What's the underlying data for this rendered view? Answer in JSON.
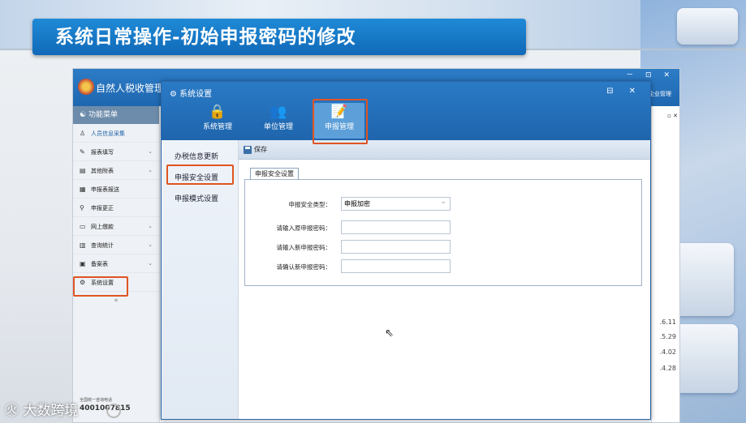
{
  "slide": {
    "title": "系统日常操作-初始申报密码的修改",
    "watermark": "大数跨境",
    "accent": "#1b7ac9",
    "highlight_color": "#e05423"
  },
  "app": {
    "title": "自然人税收管理系",
    "window_controls": "－ ⊡ ✕",
    "right_label": "企业管理",
    "nav": {
      "header": "功能菜单",
      "items": [
        {
          "label": "人员信息采集",
          "icon": "person-icon",
          "glyph": "♙",
          "expandable": false
        },
        {
          "label": "报表填写",
          "icon": "edit-icon",
          "glyph": "✎",
          "expandable": true
        },
        {
          "label": "其他附表",
          "icon": "table-icon",
          "glyph": "▤",
          "expandable": true
        },
        {
          "label": "申报表报送",
          "icon": "grid-icon",
          "glyph": "▦",
          "expandable": false
        },
        {
          "label": "申报更正",
          "icon": "search-icon",
          "glyph": "⚲",
          "expandable": false
        },
        {
          "label": "网上缴款",
          "icon": "card-icon",
          "glyph": "▭",
          "expandable": true
        },
        {
          "label": "查询统计",
          "icon": "stats-icon",
          "glyph": "▥",
          "expandable": true
        },
        {
          "label": "备案表",
          "icon": "doc-icon",
          "glyph": "▣",
          "expandable": true
        },
        {
          "label": "系统设置",
          "icon": "gear-icon",
          "glyph": "⚙",
          "expandable": false
        }
      ],
      "collapse_glyph": "«",
      "hotline_label": "全国统一咨询电话",
      "hotline_number": "4001007815"
    },
    "right_pane": {
      "tab_controls": "▫ ✕",
      "dates": [
        ".6.11",
        ".5.29",
        ".4.02",
        ".4.28"
      ]
    }
  },
  "dialog": {
    "title": "系统设置",
    "window_controls": "⊟ ✕",
    "top_tabs": [
      {
        "label": "系统管理",
        "icon": "lock-icon",
        "glyph": "🔒"
      },
      {
        "label": "单位管理",
        "icon": "users-icon",
        "glyph": "👥"
      },
      {
        "label": "申报管理",
        "icon": "report-edit-icon",
        "glyph": "📝"
      }
    ],
    "left_menu": [
      "办税信息更新",
      "申报安全设置",
      "申报模式设置"
    ],
    "toolbar": {
      "save_label": "保存"
    },
    "sub_tab": "申报安全设置",
    "form": {
      "type_label": "申报安全类型：",
      "type_value": "申报加密",
      "old_pwd_label": "请输入原申报密码：",
      "new_pwd_label": "请输入新申报密码：",
      "confirm_pwd_label": "请确认新申报密码："
    }
  }
}
